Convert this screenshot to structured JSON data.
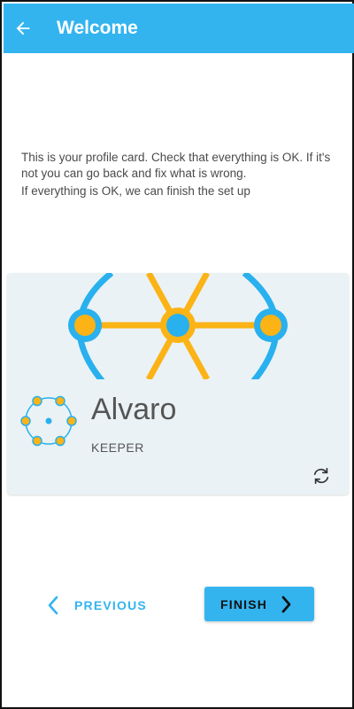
{
  "app_bar": {
    "title": "Welcome",
    "back_icon": "arrow-left-icon",
    "background": "#34b4ef"
  },
  "intro": {
    "line1": "This is your profile card. Check that everything is OK. If it's not you can go back and fix what is wrong.",
    "line2": "If everything is OK, we can finish the set up"
  },
  "profile_card": {
    "name": "Alvaro",
    "role": "KEEPER",
    "avatar_icon": "hex-dots-avatar-icon",
    "refresh_icon": "refresh-icon",
    "colors": {
      "blue": "#29b0ee",
      "orange": "#fbb315",
      "card_bg": "#eaf2f5"
    }
  },
  "nav": {
    "previous_label": "PREVIOUS",
    "finish_label": "FINISH",
    "accent": "#34b4ef"
  }
}
